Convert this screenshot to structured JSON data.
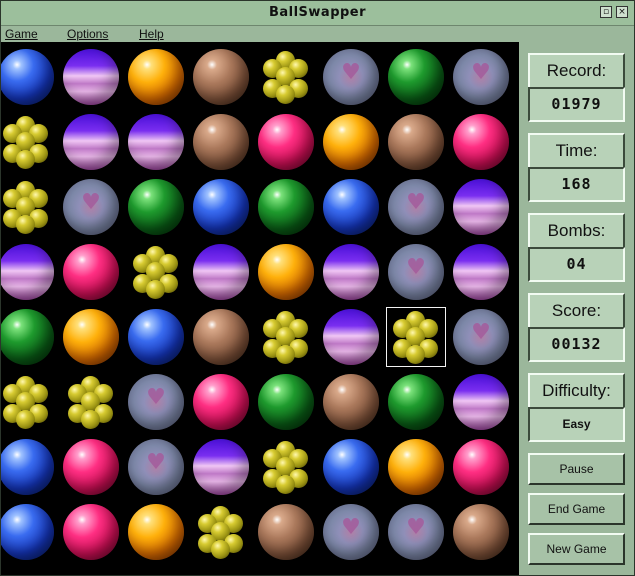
{
  "window": {
    "title": "BallSwapper"
  },
  "menu": [
    "Game",
    "Options",
    "Help"
  ],
  "board": {
    "selected": {
      "row": 4,
      "col": 6
    },
    "rows": [
      [
        "blue",
        "purple",
        "orange",
        "brown",
        "grapes",
        "heart",
        "green",
        "heart"
      ],
      [
        "grapes",
        "purple",
        "purple",
        "brown",
        "pink",
        "orange",
        "brown",
        "pink"
      ],
      [
        "grapes",
        "heart",
        "green",
        "blue",
        "green",
        "blue",
        "heart",
        "purple"
      ],
      [
        "purple",
        "pink",
        "grapes",
        "purple",
        "orange",
        "purple",
        "heart",
        "purple"
      ],
      [
        "green",
        "orange",
        "blue",
        "brown",
        "grapes",
        "purple",
        "grapes",
        "heart"
      ],
      [
        "grapes",
        "grapes",
        "heart",
        "pink",
        "green",
        "brown",
        "green",
        "purple"
      ],
      [
        "blue",
        "pink",
        "heart",
        "purple",
        "grapes",
        "blue",
        "orange",
        "pink"
      ],
      [
        "blue",
        "pink",
        "orange",
        "grapes",
        "brown",
        "heart",
        "heart",
        "brown"
      ]
    ]
  },
  "stats": {
    "record_label": "Record:",
    "record_value": "01979",
    "time_label": "Time:",
    "time_value": "168",
    "bombs_label": "Bombs:",
    "bombs_value": "04",
    "score_label": "Score:",
    "score_value": "00132",
    "difficulty_label": "Difficulty:",
    "difficulty_value": "Easy"
  },
  "buttons": {
    "pause": "Pause",
    "end_game": "End Game",
    "new_game": "New Game"
  }
}
